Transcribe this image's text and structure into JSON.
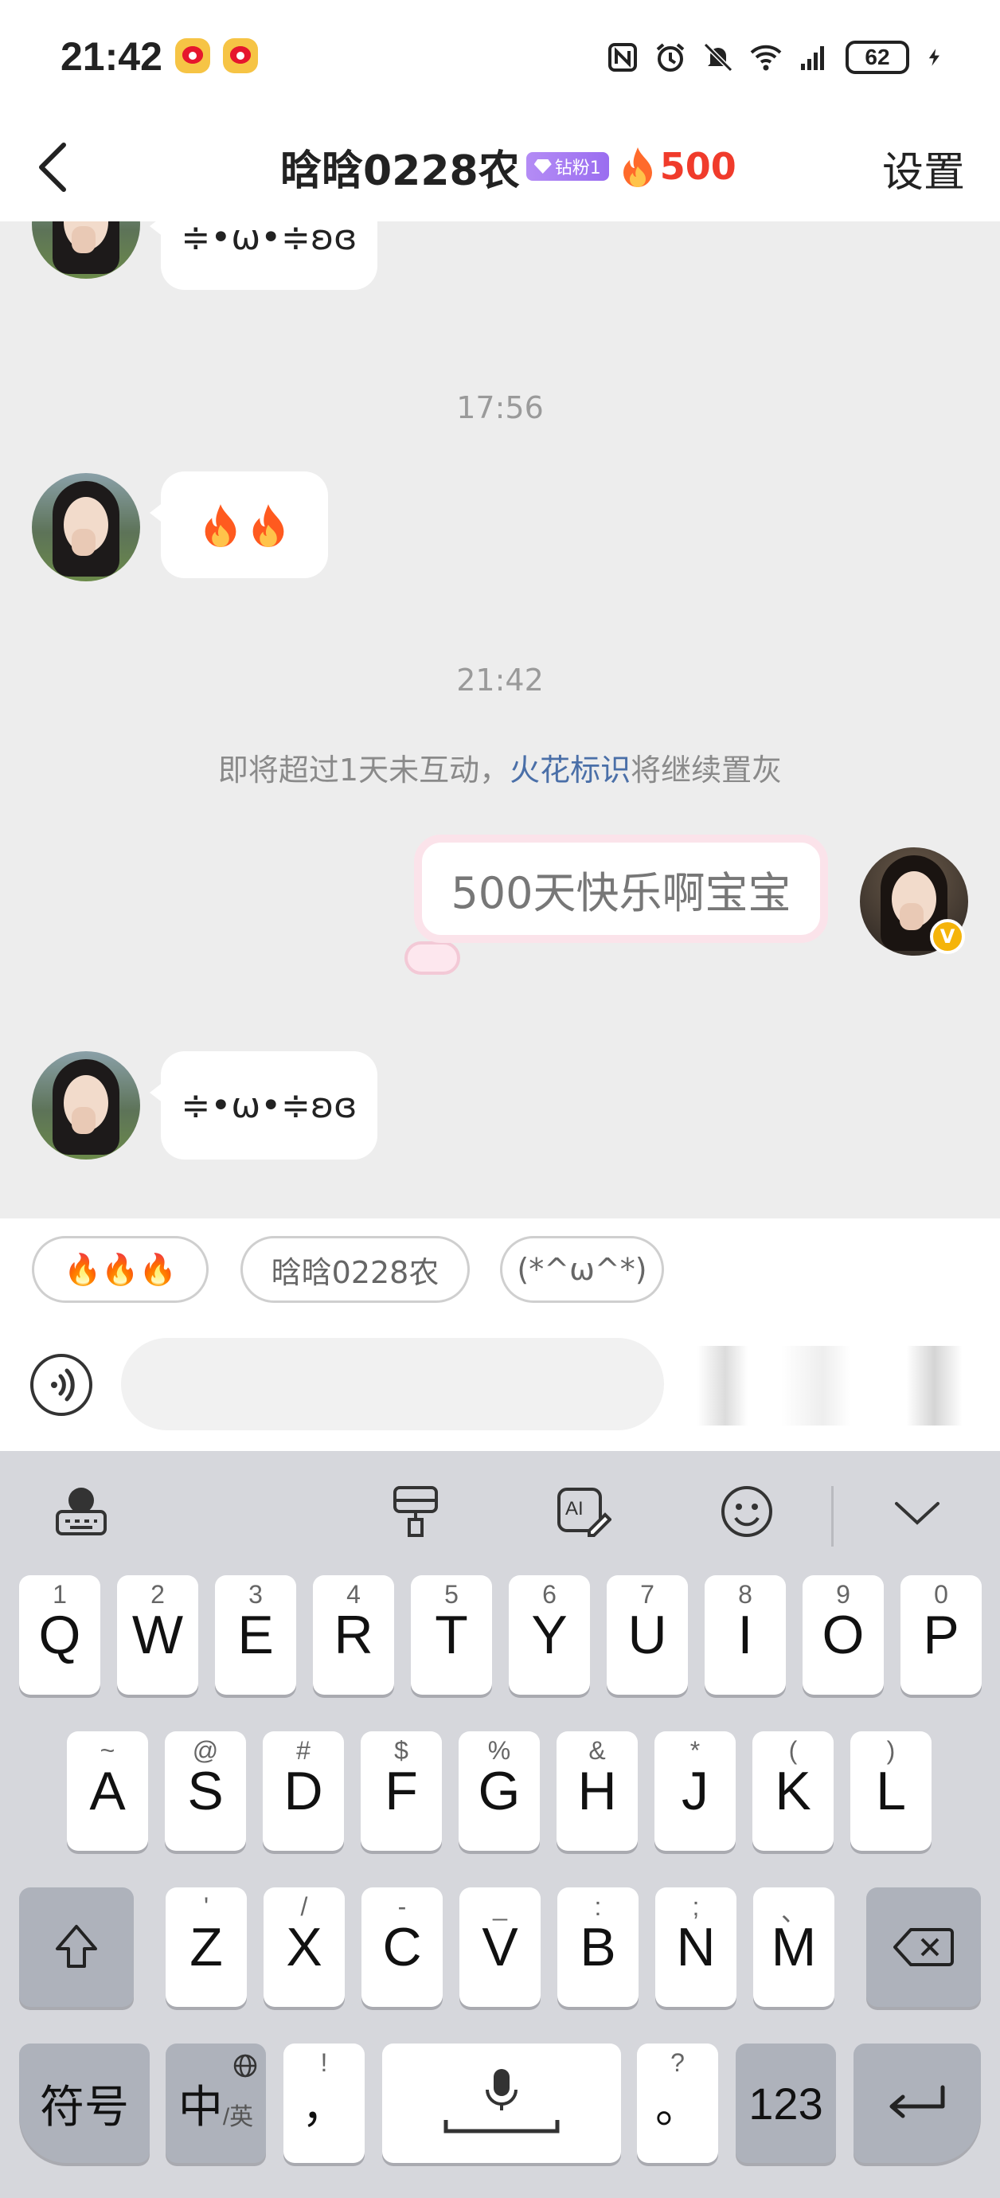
{
  "status_bar": {
    "time": "21:42",
    "battery": "62",
    "icons": [
      "nfc-icon",
      "alarm-icon",
      "mute-icon",
      "wifi-icon",
      "signal-icon",
      "battery-icon",
      "charging-icon"
    ]
  },
  "header": {
    "title": "晗晗0228农",
    "fan_badge": "钻粉1",
    "fire_count": "500",
    "settings_label": "设置"
  },
  "chat": {
    "messages": [
      {
        "sender": "other",
        "text": "≑•ω•≑ʚɞ"
      },
      {
        "timestamp": "17:56"
      },
      {
        "sender": "other",
        "content": "🔥🔥"
      },
      {
        "timestamp": "21:42"
      },
      {
        "system": "即将超过1天未互动，",
        "system_link": "火花标识",
        "system_tail": "将继续置灰"
      },
      {
        "sender": "me",
        "text": "500天快乐啊宝宝"
      },
      {
        "sender": "other",
        "text": "≑•ω•≑ʚɞ"
      }
    ],
    "verified_badge": "V"
  },
  "quick_replies": [
    "🔥🔥🔥",
    "晗晗0228农",
    "(*^ω^*)"
  ],
  "input": {
    "placeholder": ""
  },
  "keyboard": {
    "toolbar": [
      "keyboard-globe-icon",
      "brush-icon",
      "ai-edit-icon",
      "emoji-icon",
      "collapse-icon"
    ],
    "row1": [
      {
        "k": "Q",
        "s": "1"
      },
      {
        "k": "W",
        "s": "2"
      },
      {
        "k": "E",
        "s": "3"
      },
      {
        "k": "R",
        "s": "4"
      },
      {
        "k": "T",
        "s": "5"
      },
      {
        "k": "Y",
        "s": "6"
      },
      {
        "k": "U",
        "s": "7"
      },
      {
        "k": "I",
        "s": "8"
      },
      {
        "k": "O",
        "s": "9"
      },
      {
        "k": "P",
        "s": "0"
      }
    ],
    "row2": [
      {
        "k": "A",
        "s": "~"
      },
      {
        "k": "S",
        "s": "@"
      },
      {
        "k": "D",
        "s": "#"
      },
      {
        "k": "F",
        "s": "$"
      },
      {
        "k": "G",
        "s": "%"
      },
      {
        "k": "H",
        "s": "&"
      },
      {
        "k": "J",
        "s": "*"
      },
      {
        "k": "K",
        "s": "("
      },
      {
        "k": "L",
        "s": ")"
      }
    ],
    "row3": [
      {
        "k": "Z",
        "s": "'"
      },
      {
        "k": "X",
        "s": "/"
      },
      {
        "k": "C",
        "s": "-"
      },
      {
        "k": "V",
        "s": "_"
      },
      {
        "k": "B",
        "s": ":"
      },
      {
        "k": "N",
        "s": ";"
      },
      {
        "k": "M",
        "s": "、"
      }
    ],
    "symbols_label": "符号",
    "lang_label": "中",
    "lang_sub": "/英",
    "comma_label": "，",
    "comma_sub": "!",
    "period_label": "。",
    "period_sub": "?",
    "num_label": "123"
  }
}
